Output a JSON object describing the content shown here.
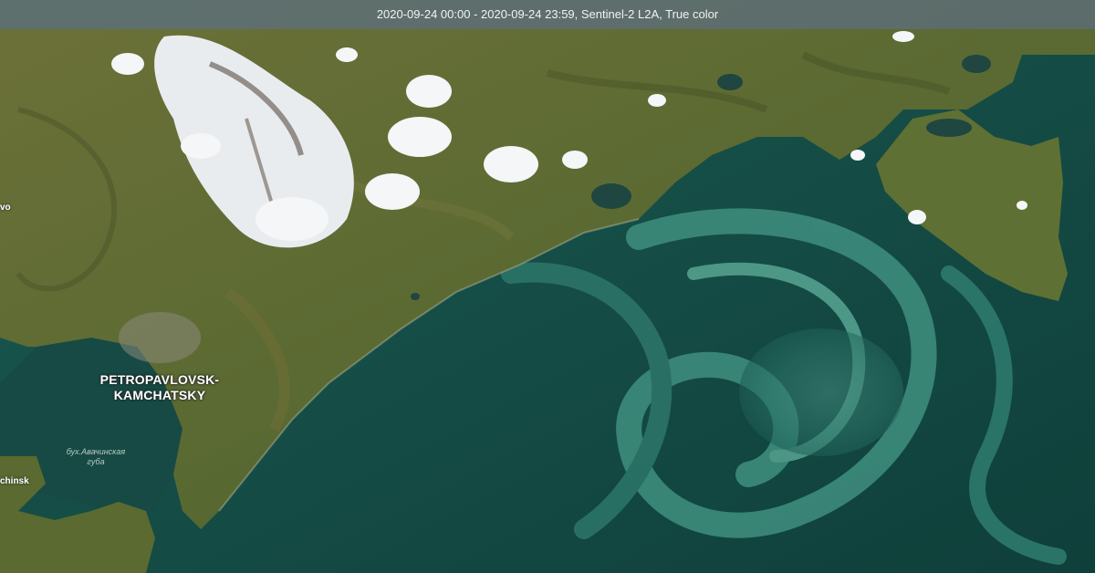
{
  "header": {
    "caption": "2020-09-24 00:00 - 2020-09-24 23:59, Sentinel-2 L2A, True color"
  },
  "labels": {
    "city_line1": "PETROPAVLOVSK-",
    "city_line2": "KAMCHATSKY",
    "bay_line1": "бух.Авачинская",
    "bay_line2": "губа",
    "left_fragment": "chinsk",
    "top_left_fragment": "vo"
  },
  "colors": {
    "land": "#5e6b36",
    "land_dark": "#4b5a2c",
    "ocean": "#16504a",
    "bloom": "#3d8a7c",
    "snow": "#f4f6f7",
    "header_bg": "#787878"
  }
}
